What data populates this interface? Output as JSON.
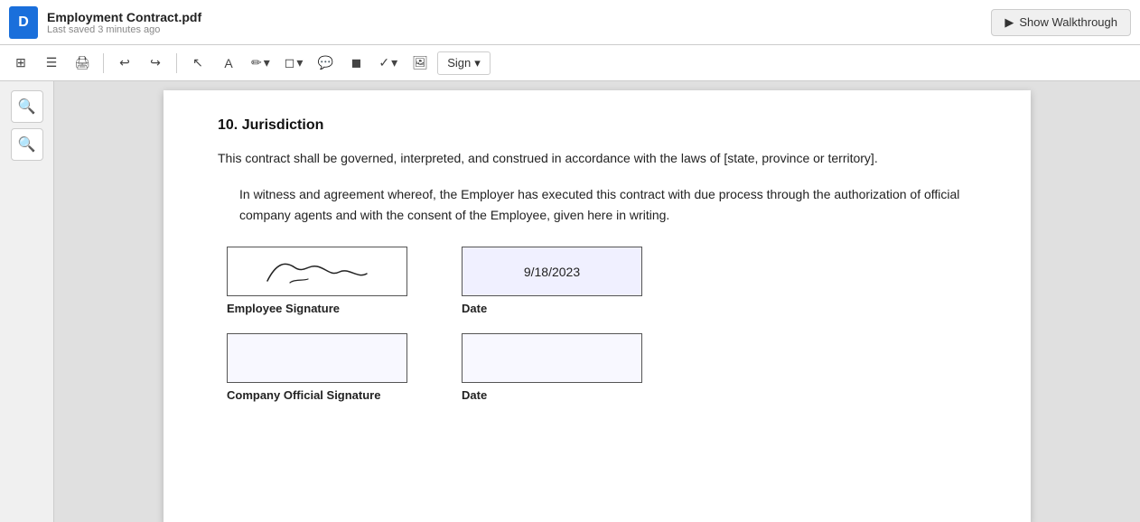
{
  "app": {
    "doc_icon_letter": "D",
    "doc_title": "Employment Contract.pdf",
    "doc_subtitle": "Last saved 3 minutes ago",
    "walkthrough_button": "Show Walkthrough"
  },
  "toolbar": {
    "undo_label": "↩",
    "redo_label": "↪",
    "text_tool": "A",
    "pen_tool": "✏",
    "highlight_tool": "◻",
    "comment_tool": "💬",
    "eraser_tool": "◼",
    "checkmark_tool": "✓",
    "image_tool": "🖼",
    "sign_label": "Sign",
    "grid_tool": "⊞",
    "pages_tool": "☰",
    "print_tool": "🖨",
    "cursor_tool": "↖"
  },
  "sidebar": {
    "zoom_in": "+",
    "zoom_out": "−"
  },
  "pdf": {
    "section_number": "10. Jurisdiction",
    "section_text": "This contract shall be governed, interpreted, and construed in accordance with the laws of [state, province or territory].",
    "witness_text": "In witness and agreement whereof, the Employer has executed this contract with due process through the authorization of official company agents and with the consent of the Employee, given here in writing.",
    "employee_sig_label": "Employee Signature",
    "employee_date_label": "Date",
    "employee_date_value": "9/18/2023",
    "company_sig_label": "Company Official Signature",
    "company_date_label": "Date",
    "company_date_value": ""
  }
}
